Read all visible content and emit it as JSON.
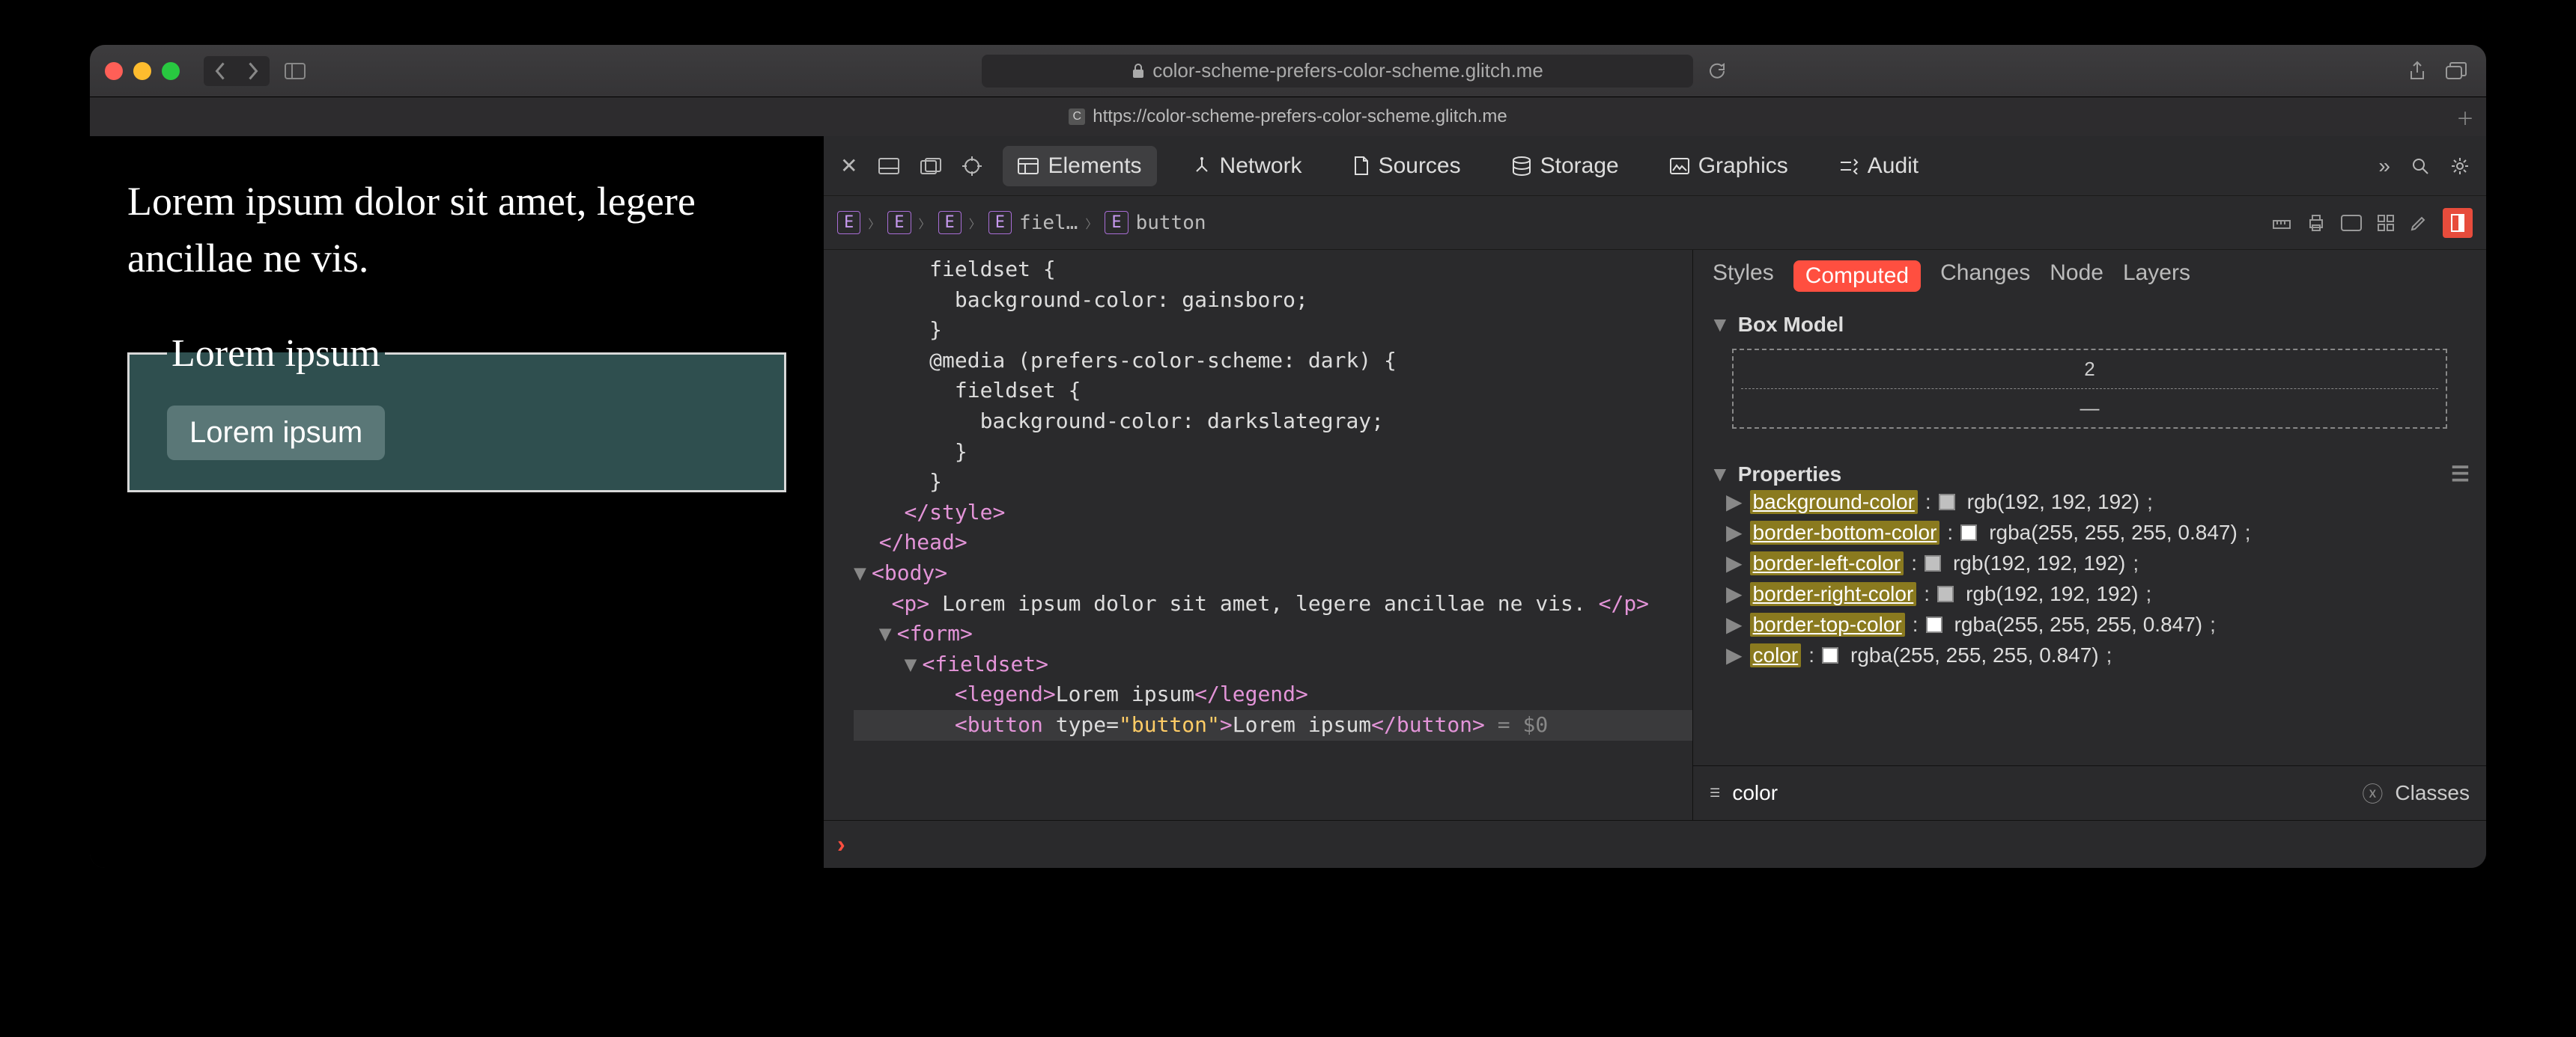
{
  "titlebar": {
    "url_host": "color-scheme-prefers-color-scheme.glitch.me"
  },
  "tabbar": {
    "tab_url": "https://color-scheme-prefers-color-scheme.glitch.me"
  },
  "page": {
    "paragraph": "Lorem ipsum dolor sit amet, legere ancillae ne vis.",
    "legend": "Lorem ipsum",
    "button_label": "Lorem ipsum"
  },
  "devtools": {
    "tabs": {
      "elements": "Elements",
      "network": "Network",
      "sources": "Sources",
      "storage": "Storage",
      "graphics": "Graphics",
      "audit": "Audit"
    },
    "breadcrumb": {
      "fiel": "fiel…",
      "button": "button"
    },
    "code": {
      "l1": "      fieldset {",
      "l2": "        background-color: gainsboro;",
      "l3": "      }",
      "l4": "      @media (prefers-color-scheme: dark) {",
      "l5": "        fieldset {",
      "l6": "          background-color: darkslategray;",
      "l7": "        }",
      "l8": "      }",
      "style_close": "</style>",
      "head_close": "</head>",
      "body_open": "<body>",
      "p_open": "<p>",
      "p_text": " Lorem ipsum dolor sit amet, legere ancillae ne vis. ",
      "p_close": "</p>",
      "form_open": "<form>",
      "fs_open": "<fieldset>",
      "leg_open": "<legend>",
      "leg_text": "Lorem ipsum",
      "leg_close": "</legend>",
      "btn_open": "<button ",
      "btn_attr_name": "type=",
      "btn_attr_val": "\"button\"",
      "btn_open_end": ">",
      "btn_text": "Lorem ipsum",
      "btn_close": "</button>",
      "eq0": " = $0"
    },
    "side": {
      "tabs": {
        "styles": "Styles",
        "computed": "Computed",
        "changes": "Changes",
        "node": "Node",
        "layers": "Layers"
      },
      "box_model_label": "Box Model",
      "box_top": "2",
      "box_dash": "—",
      "properties_label": "Properties",
      "props": [
        {
          "name": "background-color",
          "value": "rgb(192, 192, 192)",
          "sw": "#c0c0c0"
        },
        {
          "name": "border-bottom-color",
          "value": "rgba(255, 255, 255, 0.847)",
          "sw": "#ffffff"
        },
        {
          "name": "border-left-color",
          "value": "rgb(192, 192, 192)",
          "sw": "#c0c0c0"
        },
        {
          "name": "border-right-color",
          "value": "rgb(192, 192, 192)",
          "sw": "#c0c0c0"
        },
        {
          "name": "border-top-color",
          "value": "rgba(255, 255, 255, 0.847)",
          "sw": "#ffffff"
        },
        {
          "name": "color",
          "value": "rgba(255, 255, 255, 0.847)",
          "sw": "#ffffff"
        }
      ],
      "filter_value": "color",
      "classes_label": "Classes"
    }
  }
}
